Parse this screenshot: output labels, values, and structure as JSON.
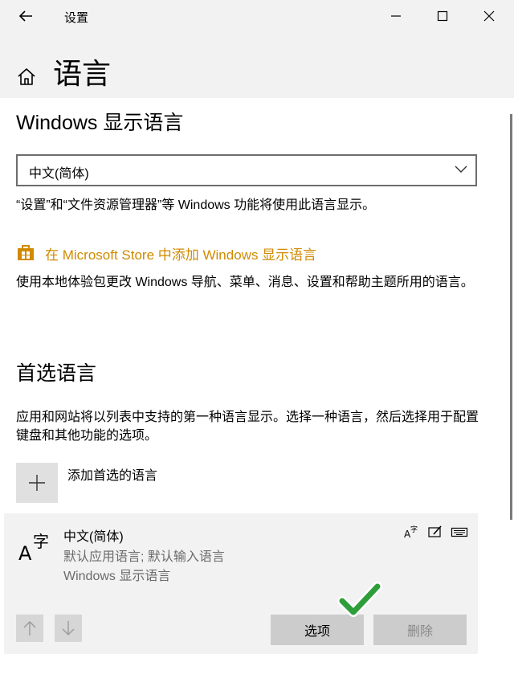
{
  "window": {
    "title": "设置",
    "controls": [
      "minimize-icon",
      "maximize-icon",
      "close-icon"
    ]
  },
  "page": {
    "title": "语言",
    "home_icon": "home-icon"
  },
  "display_language": {
    "heading": "Windows 显示语言",
    "dropdown_value": "中文(简体)",
    "description": "“设置”和“文件资源管理器”等 Windows 功能将使用此语言显示。",
    "store_link": "在 Microsoft Store 中添加 Windows 显示语言",
    "store_description": "使用本地体验包更改 Windows 导航、菜单、消息、设置和帮助主题所用的语言。"
  },
  "preferred_languages": {
    "heading": "首选语言",
    "description": "应用和网站将以列表中支持的第一种语言显示。选择一种语言，然后选择用于配置键盘和其他功能的选项。",
    "add_label": "添加首选的语言",
    "items": [
      {
        "name": "中文(简体)",
        "line1": "默认应用语言; 默认输入语言",
        "line2": "Windows 显示语言",
        "feature_icons": [
          "display-language-icon",
          "handwriting-icon",
          "keyboard-icon"
        ]
      }
    ],
    "options_button": "选项",
    "remove_button": "删除"
  },
  "colors": {
    "accent_link": "#d08a00",
    "checkmark": "#2e9e3a",
    "background": "#f2f2f2"
  }
}
